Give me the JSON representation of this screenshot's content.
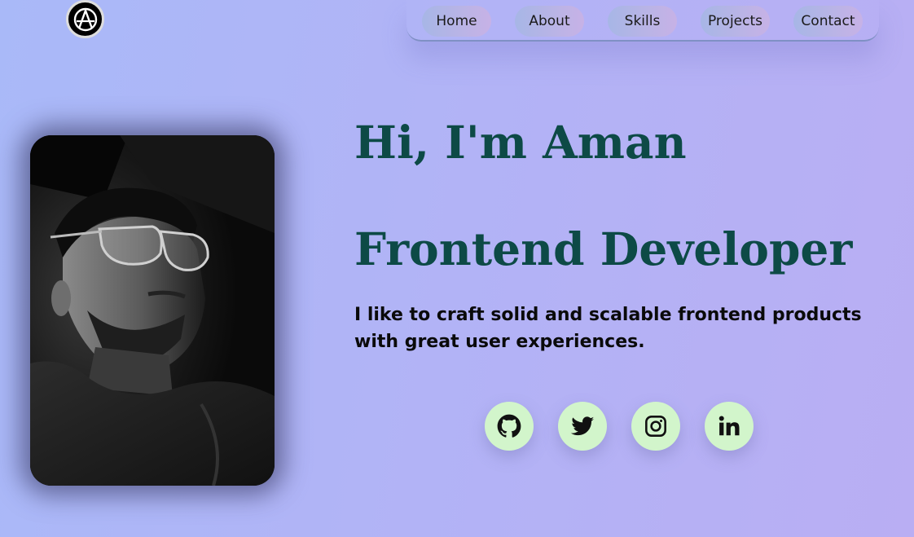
{
  "logo": {
    "icon": "anarchy-a-logo-icon"
  },
  "nav": {
    "items": [
      {
        "label": "Home"
      },
      {
        "label": "About"
      },
      {
        "label": "Skills"
      },
      {
        "label": "Projects"
      },
      {
        "label": "Contact"
      }
    ]
  },
  "hero": {
    "greeting": "Hi, I'm Aman",
    "role": "Frontend Developer",
    "tagline": "I like to craft solid and scalable frontend products with great user experiences."
  },
  "social": [
    {
      "icon": "github-icon"
    },
    {
      "icon": "twitter-icon"
    },
    {
      "icon": "instagram-icon"
    },
    {
      "icon": "linkedin-icon"
    }
  ],
  "colors": {
    "accent": "#0d4a46",
    "social_bg": "#d2f5cb",
    "nav_pill_from": "#a7b6e6",
    "nav_pill_to": "#c7b2e6"
  }
}
